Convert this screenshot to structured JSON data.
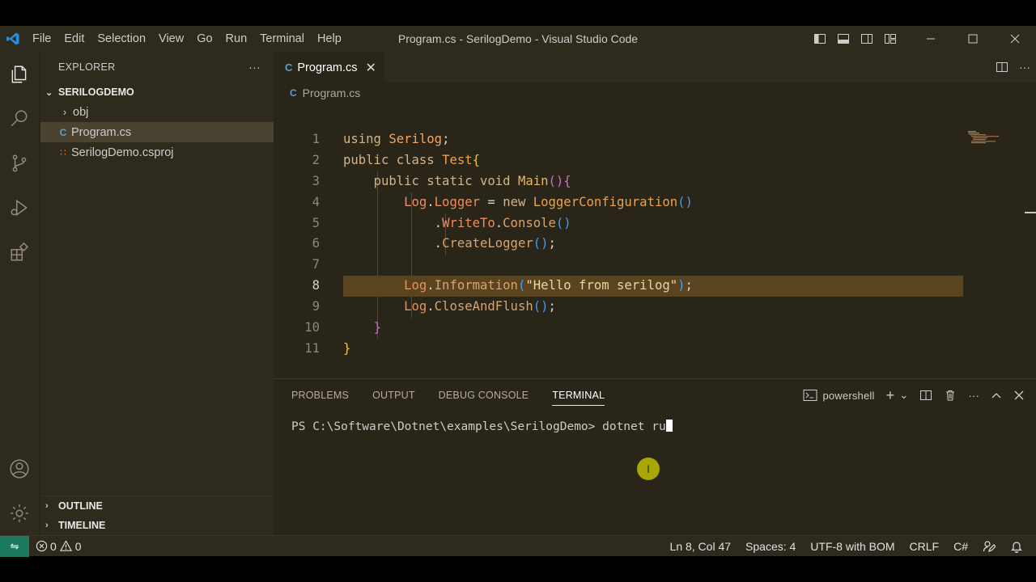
{
  "window_title": "Program.cs - SerilogDemo - Visual Studio Code",
  "menu": [
    "File",
    "Edit",
    "Selection",
    "View",
    "Go",
    "Run",
    "Terminal",
    "Help"
  ],
  "sidebar": {
    "header": "EXPLORER",
    "more": "···",
    "project": "SERILOGDEMO",
    "items": [
      {
        "label": "obj",
        "icon": "chevron-right-icon"
      },
      {
        "label": "Program.cs",
        "icon": "csharp-file-icon"
      },
      {
        "label": "SerilogDemo.csproj",
        "icon": "rss-file-icon"
      }
    ],
    "outline": "OUTLINE",
    "timeline": "TIMELINE"
  },
  "editor": {
    "tab_label": "Program.cs",
    "breadcrumb": "Program.cs",
    "line_numbers": [
      "1",
      "2",
      "3",
      "4",
      "5",
      "6",
      "7",
      "8",
      "9",
      "10",
      "11"
    ],
    "active_line": "8"
  },
  "panel": {
    "tabs": [
      "PROBLEMS",
      "OUTPUT",
      "DEBUG CONSOLE",
      "TERMINAL"
    ],
    "active_tab": "TERMINAL",
    "shell": "powershell",
    "prompt": "PS C:\\Software\\Dotnet\\examples\\SerilogDemo> ",
    "command": "dotnet ru"
  },
  "statusbar": {
    "errors": "0",
    "warnings": "0",
    "position": "Ln 8, Col 47",
    "spaces": "Spaces: 4",
    "encoding": "UTF-8 with BOM",
    "eol": "CRLF",
    "language": "C#"
  },
  "colors": {
    "background": "#2a2519",
    "chrome": "#2f2a1e",
    "highlight_line": "#5a4420",
    "accent_blue": "#3d9ef6"
  }
}
